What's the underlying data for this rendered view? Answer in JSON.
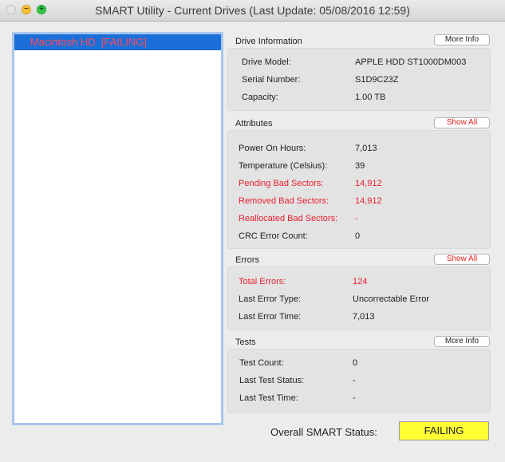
{
  "window": {
    "title": "SMART Utility - Current Drives (Last Update: 05/08/2016 12:59)"
  },
  "drives": [
    {
      "name": "Macintosh HD  [FAILING]"
    }
  ],
  "drive_information": {
    "title": "Drive Information",
    "button": "More Info",
    "rows": [
      {
        "label": "Drive Model:",
        "value": "APPLE HDD ST1000DM003"
      },
      {
        "label": "Serial Number:",
        "value": "S1D9C23Z"
      },
      {
        "label": "Capacity:",
        "value": "1.00 TB"
      }
    ]
  },
  "attributes": {
    "title": "Attributes",
    "button": "Show All",
    "rows": [
      {
        "label": "Power On Hours:",
        "value": "7,013"
      },
      {
        "label": "Temperature (Celsius):",
        "value": "39"
      },
      {
        "label": "Pending Bad Sectors:",
        "value": "14,912"
      },
      {
        "label": "Removed Bad Sectors:",
        "value": "14,912"
      },
      {
        "label": "Reallocated Bad Sectors:",
        "value": "-"
      },
      {
        "label": "CRC Error Count:",
        "value": "0"
      }
    ]
  },
  "errors": {
    "title": "Errors",
    "button": "Show All",
    "rows": [
      {
        "label": "Total Errors:",
        "value": "124"
      },
      {
        "label": "Last Error Type:",
        "value": "Uncorrectable Error"
      },
      {
        "label": "Last Error Time:",
        "value": "7,013"
      }
    ]
  },
  "tests": {
    "title": "Tests",
    "button": "More Info",
    "rows": [
      {
        "label": "Test Count:",
        "value": "0"
      },
      {
        "label": "Last Test Status:",
        "value": "-"
      },
      {
        "label": "Last Test Time:",
        "value": "-"
      }
    ]
  },
  "overall": {
    "label": "Overall SMART Status:",
    "status": "FAILING"
  },
  "colors": {
    "failing_text": "#e8202f",
    "status_bg": "#ffff33",
    "selection": "#1a70d8"
  }
}
